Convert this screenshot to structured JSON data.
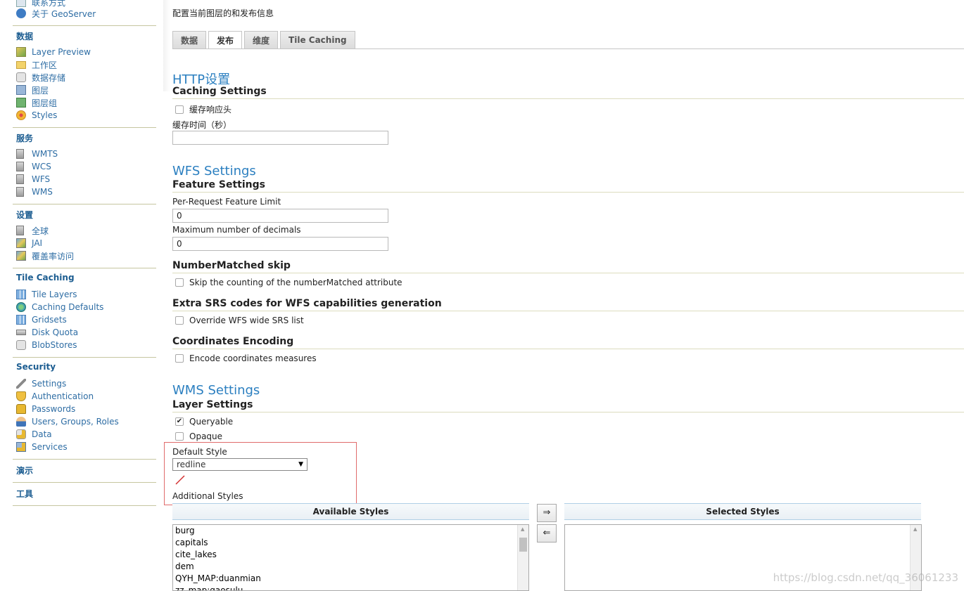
{
  "sidebar": {
    "top_items": [
      {
        "label": "联系方式",
        "icon": "contact-icon"
      },
      {
        "label": "关于 GeoServer",
        "icon": "about-icon"
      }
    ],
    "sections": [
      {
        "heading": "数据",
        "items": [
          {
            "label": "Layer Preview",
            "icon": "layer-preview-icon"
          },
          {
            "label": "工作区",
            "icon": "folder-icon"
          },
          {
            "label": "数据存储",
            "icon": "database-icon"
          },
          {
            "label": "图层",
            "icon": "layer-icon"
          },
          {
            "label": "图层组",
            "icon": "layer-group-icon"
          },
          {
            "label": "Styles",
            "icon": "palette-icon"
          }
        ]
      },
      {
        "heading": "服务",
        "items": [
          {
            "label": "WMTS",
            "icon": "server-icon"
          },
          {
            "label": "WCS",
            "icon": "server-icon"
          },
          {
            "label": "WFS",
            "icon": "server-icon"
          },
          {
            "label": "WMS",
            "icon": "server-icon"
          }
        ]
      },
      {
        "heading": "设置",
        "items": [
          {
            "label": "全球",
            "icon": "server-icon"
          },
          {
            "label": "JAI",
            "icon": "image-icon"
          },
          {
            "label": "覆盖率访问",
            "icon": "image-icon"
          }
        ]
      },
      {
        "heading": "Tile Caching",
        "items": [
          {
            "label": "Tile Layers",
            "icon": "grid-icon"
          },
          {
            "label": "Caching Defaults",
            "icon": "globe-icon"
          },
          {
            "label": "Gridsets",
            "icon": "grid-icon"
          },
          {
            "label": "Disk Quota",
            "icon": "disk-icon"
          },
          {
            "label": "BlobStores",
            "icon": "database-icon"
          }
        ]
      },
      {
        "heading": "Security",
        "items": [
          {
            "label": "Settings",
            "icon": "wrench-icon"
          },
          {
            "label": "Authentication",
            "icon": "shield-icon"
          },
          {
            "label": "Passwords",
            "icon": "lock-icon"
          },
          {
            "label": "Users, Groups, Roles",
            "icon": "users-icon"
          },
          {
            "label": "Data",
            "icon": "data-lock-icon"
          },
          {
            "label": "Services",
            "icon": "services-lock-icon"
          }
        ]
      },
      {
        "heading": "演示",
        "items": []
      },
      {
        "heading": "工具",
        "items": []
      }
    ]
  },
  "main": {
    "intro": "配置当前图层的和发布信息",
    "tabs": [
      "数据",
      "发布",
      "维度",
      "Tile Caching"
    ],
    "active_tab": "发布",
    "http": {
      "title": "HTTP设置",
      "subtitle": "Caching Settings",
      "cache_headers_label": "缓存响应头",
      "cache_headers_checked": false,
      "cache_time_label": "缓存时间（秒）",
      "cache_time_value": ""
    },
    "wfs": {
      "title": "WFS Settings",
      "subtitle": "Feature Settings",
      "limit_label": "Per-Request Feature Limit",
      "limit_value": "0",
      "decimals_label": "Maximum number of decimals",
      "decimals_value": "0",
      "nm_title": "NumberMatched skip",
      "nm_label": "Skip the counting of the numberMatched attribute",
      "srs_title": "Extra SRS codes for WFS capabilities generation",
      "srs_label": "Override WFS wide SRS list",
      "coord_title": "Coordinates Encoding",
      "coord_label": "Encode coordinates measures"
    },
    "wms": {
      "title": "WMS Settings",
      "subtitle": "Layer Settings",
      "queryable_label": "Queryable",
      "queryable_checked": true,
      "opaque_label": "Opaque",
      "opaque_checked": false,
      "default_style_label": "Default Style",
      "default_style_value": "redline",
      "additional_styles_label": "Additional Styles",
      "available_header": "Available Styles",
      "selected_header": "Selected Styles",
      "available_styles": [
        "burg",
        "capitals",
        "cite_lakes",
        "dem",
        "QYH_MAP:duanmian",
        "zz_map:gaosulu"
      ],
      "selected_styles": [],
      "move_right": "⇒",
      "move_left": "⇐"
    }
  },
  "watermark": "https://blog.csdn.net/qq_36061233"
}
